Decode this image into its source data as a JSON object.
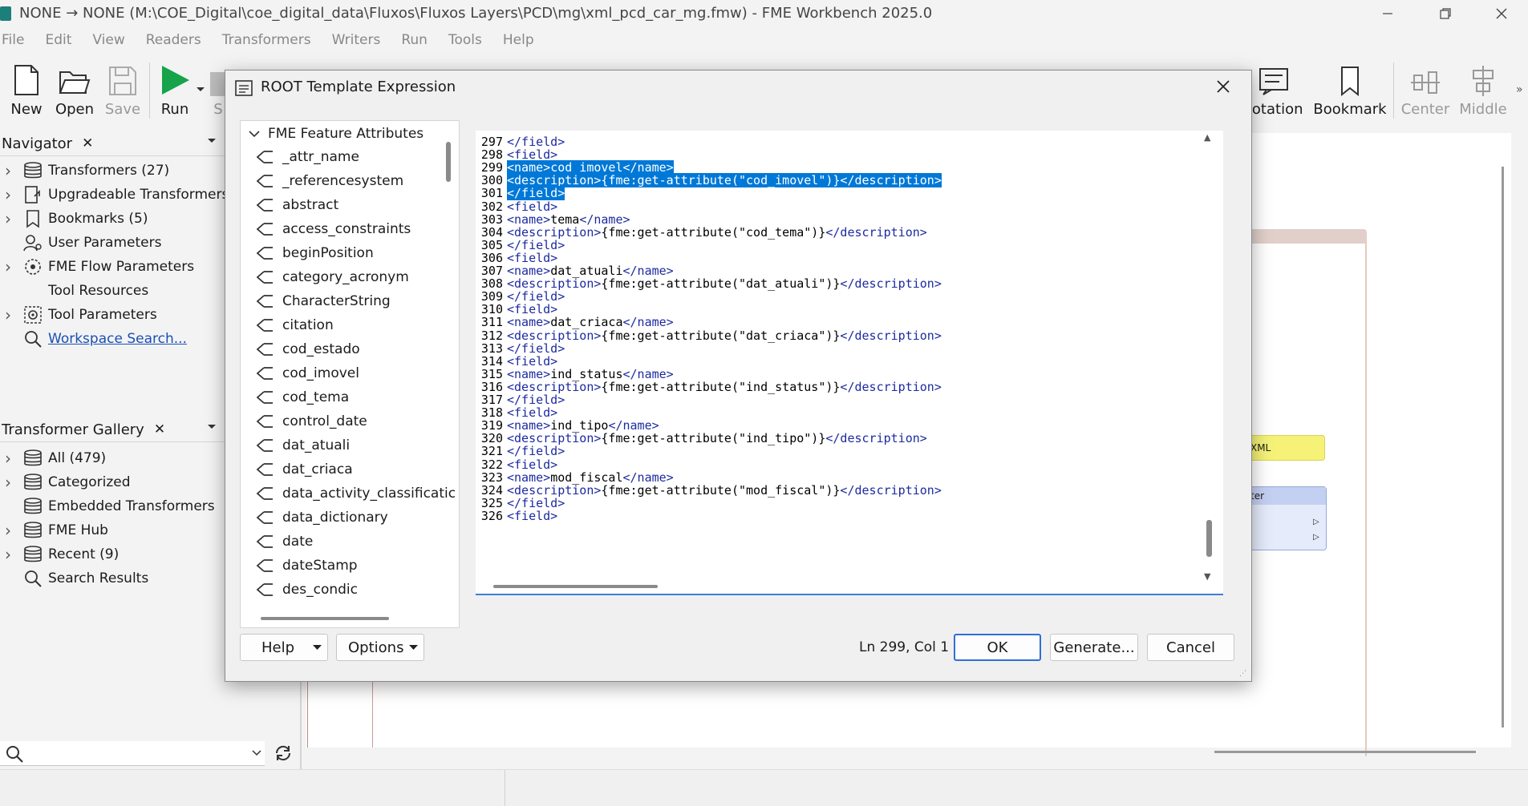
{
  "window": {
    "title": "NONE → NONE (M:\\COE_Digital\\coe_digital_data\\Fluxos\\Fluxos Layers\\PCD\\mg\\xml_pcd_car_mg.fmw) - FME Workbench 2025.0"
  },
  "menu": [
    "File",
    "Edit",
    "View",
    "Readers",
    "Transformers",
    "Writers",
    "Run",
    "Tools",
    "Help"
  ],
  "toolbar": {
    "new": "New",
    "open": "Open",
    "save": "Save",
    "run": "Run",
    "s_partial": "S",
    "annotation_partial": "notation",
    "bookmark": "Bookmark",
    "center": "Center",
    "middle": "Middle"
  },
  "navigator": {
    "title": "Navigator",
    "items": [
      {
        "label": "Transformers (27)",
        "icon": "stack-icon"
      },
      {
        "label": "Upgradeable Transformers (",
        "icon": "upgrade-icon"
      },
      {
        "label": "Bookmarks (5)",
        "icon": "bookmark-icon"
      },
      {
        "label": "User Parameters",
        "icon": "user-params-icon"
      },
      {
        "label": "FME Flow Parameters",
        "icon": "flow-params-icon"
      },
      {
        "label": "Tool Resources",
        "icon": "resources-icon"
      },
      {
        "label": "Tool Parameters",
        "icon": "tool-params-icon"
      },
      {
        "label": "Workspace Search...",
        "icon": "search-icon"
      }
    ]
  },
  "gallery": {
    "title": "Transformer Gallery",
    "items": [
      {
        "label": "All (479)"
      },
      {
        "label": "Categorized"
      },
      {
        "label": "Embedded Transformers"
      },
      {
        "label": "FME Hub"
      },
      {
        "label": "Recent (9)"
      },
      {
        "label": "Search Results"
      }
    ]
  },
  "canvas": {
    "node_xml_partial": "XML",
    "node_ter_partial": "ter"
  },
  "dialog": {
    "title": "ROOT Template Expression",
    "tree_root": "FME Feature Attributes",
    "attributes": [
      "_attr_name",
      "_referencesystem",
      "abstract",
      "access_constraints",
      "beginPosition",
      "category_acronym",
      "CharacterString",
      "citation",
      "cod_estado",
      "cod_imovel",
      "cod_tema",
      "control_date",
      "dat_atuali",
      "dat_criaca",
      "data_activity_classificatic",
      "data_dictionary",
      "date",
      "dateStamp",
      "des_condic"
    ],
    "code_lines": [
      {
        "n": "297",
        "t": "</field>",
        "sel": false
      },
      {
        "n": "298",
        "t": "<field>",
        "sel": false
      },
      {
        "n": "299",
        "t": "<name>cod_imovel</name>",
        "sel": true
      },
      {
        "n": "300",
        "t": "<description>{fme:get-attribute(\"cod_imovel\")}</description>",
        "sel": true
      },
      {
        "n": "301",
        "t": "</field>",
        "sel": true
      },
      {
        "n": "302",
        "t": "<field>",
        "sel": false
      },
      {
        "n": "303",
        "t": "<name>tema</name>",
        "sel": false
      },
      {
        "n": "304",
        "t": "<description>{fme:get-attribute(\"cod_tema\")}</description>",
        "sel": false
      },
      {
        "n": "305",
        "t": "</field>",
        "sel": false
      },
      {
        "n": "306",
        "t": "<field>",
        "sel": false
      },
      {
        "n": "307",
        "t": "<name>dat_atuali</name>",
        "sel": false
      },
      {
        "n": "308",
        "t": "<description>{fme:get-attribute(\"dat_atuali\")}</description>",
        "sel": false
      },
      {
        "n": "309",
        "t": "</field>",
        "sel": false
      },
      {
        "n": "310",
        "t": "<field>",
        "sel": false
      },
      {
        "n": "311",
        "t": "<name>dat_criaca</name>",
        "sel": false
      },
      {
        "n": "312",
        "t": "<description>{fme:get-attribute(\"dat_criaca\")}</description>",
        "sel": false
      },
      {
        "n": "313",
        "t": "</field>",
        "sel": false
      },
      {
        "n": "314",
        "t": "<field>",
        "sel": false
      },
      {
        "n": "315",
        "t": "<name>ind_status</name>",
        "sel": false
      },
      {
        "n": "316",
        "t": "<description>{fme:get-attribute(\"ind_status\")}</description>",
        "sel": false
      },
      {
        "n": "317",
        "t": "</field>",
        "sel": false
      },
      {
        "n": "318",
        "t": "<field>",
        "sel": false
      },
      {
        "n": "319",
        "t": "<name>ind_tipo</name>",
        "sel": false
      },
      {
        "n": "320",
        "t": "<description>{fme:get-attribute(\"ind_tipo\")}</description>",
        "sel": false
      },
      {
        "n": "321",
        "t": "</field>",
        "sel": false
      },
      {
        "n": "322",
        "t": "<field>",
        "sel": false
      },
      {
        "n": "323",
        "t": "<name>mod_fiscal</name>",
        "sel": false
      },
      {
        "n": "324",
        "t": "<description>{fme:get-attribute(\"mod_fiscal\")}</description>",
        "sel": false
      },
      {
        "n": "325",
        "t": "</field>",
        "sel": false
      },
      {
        "n": "326",
        "t": "<field>",
        "sel": false
      }
    ],
    "help": "Help",
    "options": "Options",
    "cursor_pos": "Ln 299, Col 1",
    "ok": "OK",
    "generate": "Generate...",
    "cancel": "Cancel"
  },
  "colors": {
    "run_green": "#16a34a",
    "selection": "#0078d7",
    "tag_blue": "#1c2aa0",
    "editor_underline": "#3b7ed6"
  }
}
